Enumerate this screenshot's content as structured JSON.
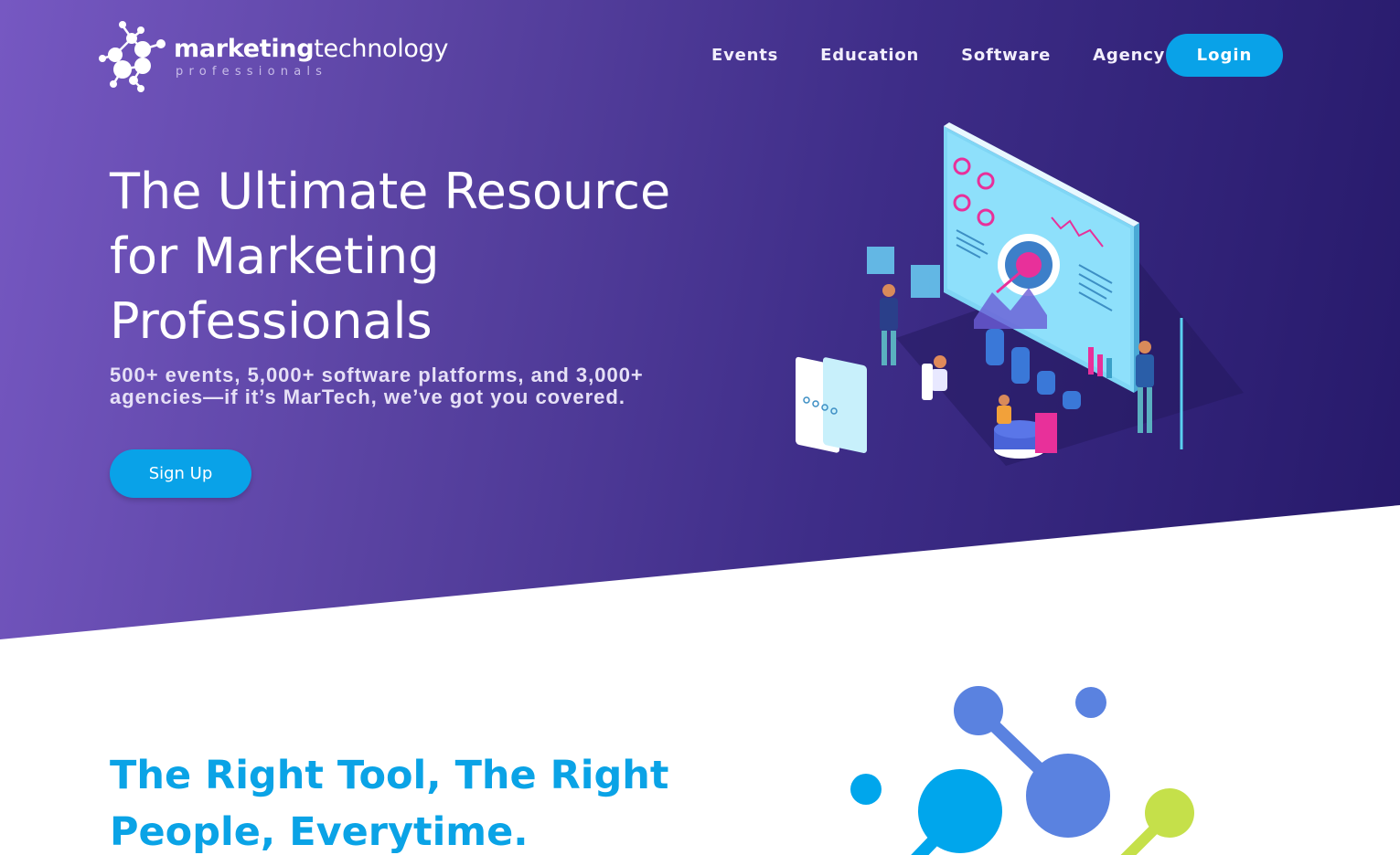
{
  "brand": {
    "name_bold": "marketing",
    "name_thin": "technology",
    "tagline": "professionals",
    "logo_icon": "molecule-logo-icon"
  },
  "nav": {
    "items": [
      {
        "label": "Events"
      },
      {
        "label": "Education"
      },
      {
        "label": "Software"
      },
      {
        "label": "Agency"
      }
    ],
    "login_label": "Login"
  },
  "hero": {
    "title_lines": [
      "The Ultimate Resource",
      "for Marketing",
      "Professionals"
    ],
    "subtitle_lines": [
      "500+ events, 5,000+ software platforms, and 3,000+",
      "agencies—if it’s MarTech, we’ve got you covered."
    ],
    "cta_label": "Sign Up",
    "illustration": "isometric-analytics-illustration"
  },
  "section": {
    "title_lines": [
      "The Right Tool, The Right",
      "People, Everytime."
    ],
    "graphic": "molecule-graphic"
  },
  "colors": {
    "hero_gradient_start": "#7658c2",
    "hero_gradient_end": "#26196a",
    "accent_blue": "#09a2e8",
    "molecule_blue": "#5a82e0",
    "molecule_green": "#c5e04a",
    "white": "#ffffff"
  }
}
